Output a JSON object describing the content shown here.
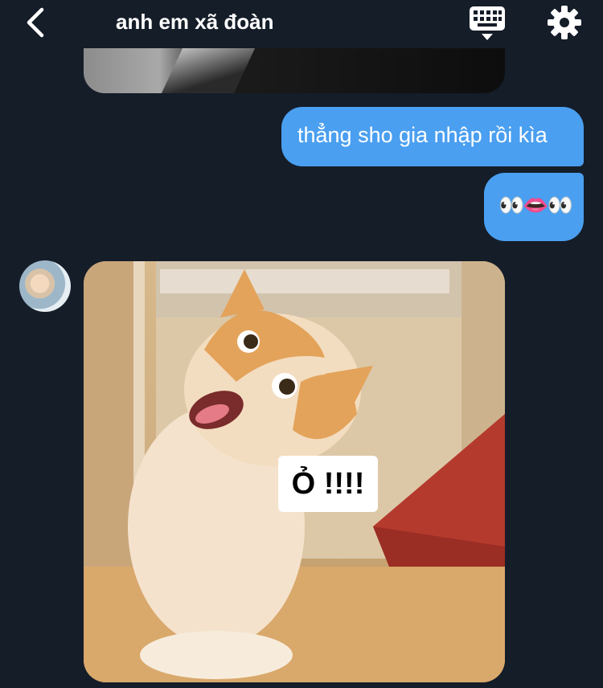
{
  "header": {
    "title": "anh em xã đoàn",
    "back_icon": "chevron-left-icon",
    "keyboard_icon": "keyboard-icon",
    "settings_icon": "gear-icon"
  },
  "messages": [
    {
      "sender": "me",
      "text": "thẳng sho gia nhập rồi kìa"
    },
    {
      "sender": "me",
      "text": "👀👄👀"
    }
  ],
  "meme": {
    "caption": "Ỏ !!!!"
  },
  "colors": {
    "background": "#151d29",
    "outgoing_bubble": "#4a9ff0",
    "text": "#ffffff"
  }
}
